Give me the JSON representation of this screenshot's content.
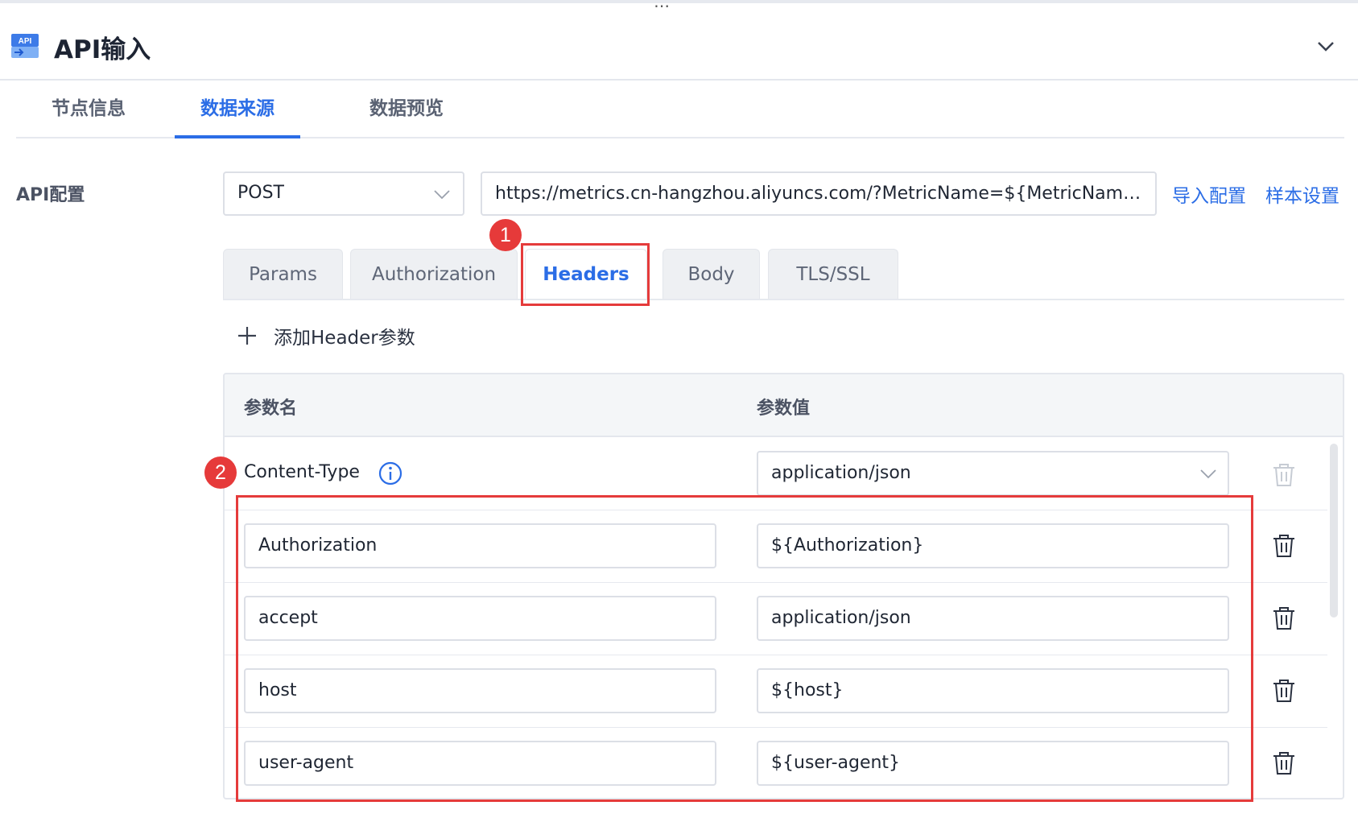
{
  "header": {
    "icon_text": "API",
    "title": "API输入"
  },
  "tabs": [
    {
      "label": "节点信息",
      "active": false
    },
    {
      "label": "数据来源",
      "active": true
    },
    {
      "label": "数据预览",
      "active": false
    }
  ],
  "api_config": {
    "label": "API配置",
    "method": "POST",
    "url": "https://metrics.cn-hangzhou.aliyuncs.com/?MetricName=${MetricName}&...",
    "import_link": "导入配置",
    "sample_link": "样本设置"
  },
  "subtabs": [
    {
      "label": "Params",
      "active": false
    },
    {
      "label": "Authorization",
      "active": false
    },
    {
      "label": "Headers",
      "active": true
    },
    {
      "label": "Body",
      "active": false
    },
    {
      "label": "TLS/SSL",
      "active": false
    }
  ],
  "annotations": {
    "badge1": "1",
    "badge2": "2"
  },
  "add_header_label": "添加Header参数",
  "table": {
    "col_name": "参数名",
    "col_value": "参数值",
    "fixed_row": {
      "name": "Content-Type",
      "value": "application/json"
    },
    "rows": [
      {
        "name": "Authorization",
        "value": "${Authorization}"
      },
      {
        "name": "accept",
        "value": "application/json"
      },
      {
        "name": "host",
        "value": "${host}"
      },
      {
        "name": "user-agent",
        "value": "${user-agent}"
      }
    ]
  },
  "colors": {
    "accent": "#2b6de6",
    "highlight": "#e53b3b"
  }
}
